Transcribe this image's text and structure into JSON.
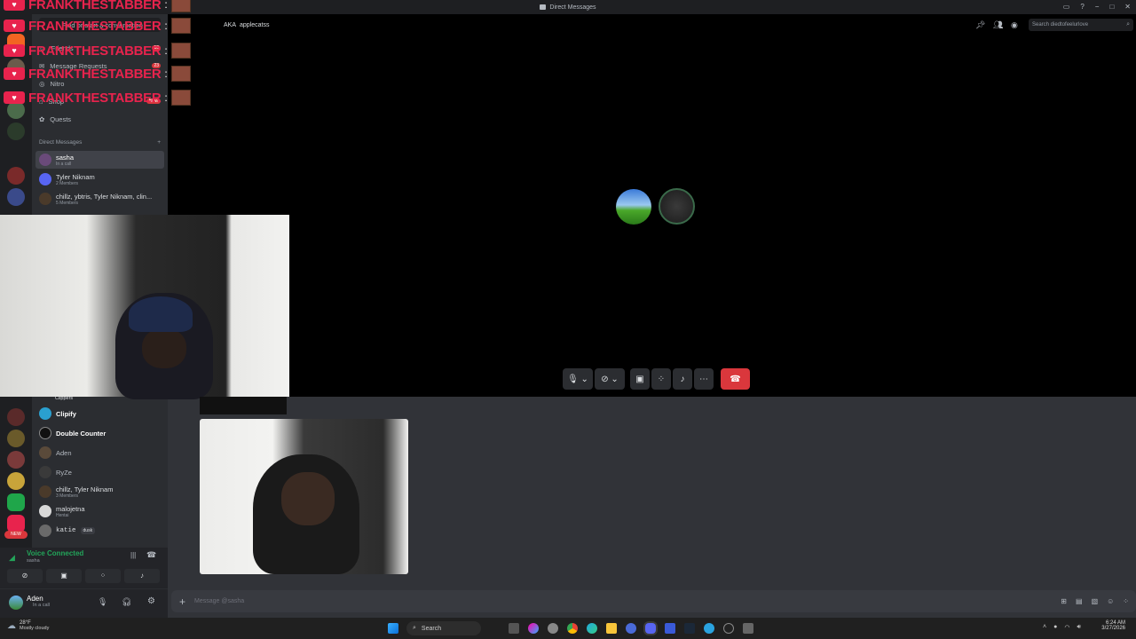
{
  "window": {
    "title": "Direct Messages",
    "controls": [
      "−",
      "□",
      "✕"
    ]
  },
  "overlay": {
    "repeat_name": "FRANKTHESTABBER",
    "rows": 5
  },
  "sidebar": {
    "nav": [
      {
        "label": "Find or start a conversation"
      },
      {
        "label": "Friends",
        "count": "10"
      },
      {
        "label": "Message Requests",
        "count": "23"
      },
      {
        "label": "Nitro"
      },
      {
        "label": "Shop",
        "badge": "New"
      },
      {
        "label": "Quests"
      }
    ],
    "dm_header": "Direct Messages",
    "dms_top": [
      {
        "name": "sasha",
        "status": "In a call"
      },
      {
        "name": "Tyler Niknam",
        "status": "2 Members"
      },
      {
        "name": "chillz, ybtris, Tyler Niknam, clin...",
        "status": "5 Members"
      }
    ],
    "dms_bottom": [
      {
        "name": "Clippers",
        "status": ""
      },
      {
        "name": "Clipify",
        "status": ""
      },
      {
        "name": "Double Counter",
        "status": ""
      },
      {
        "name": "Aden",
        "status": ""
      },
      {
        "name": "RyZe",
        "status": ""
      },
      {
        "name": "chillz, Tyler Niknam",
        "status": "3 Members"
      },
      {
        "name": "malojetna",
        "status": "Hentai"
      },
      {
        "name": "katie",
        "status": "dusk"
      }
    ]
  },
  "voice": {
    "title": "Voice Connected",
    "channel": "sasha"
  },
  "user": {
    "name": "Aden",
    "status": "In a call"
  },
  "call": {
    "topbar_names": [
      "AKA",
      "applecatss"
    ],
    "search_placeholder": "Search diedtofeelurlove"
  },
  "message": {
    "placeholder": "Message @sasha"
  },
  "taskbar": {
    "weather_temp": "28°F",
    "weather_desc": "Mostly cloudy",
    "search_label": "Search",
    "time": "6:24 AM",
    "date": "3/27/2026"
  },
  "colors": {
    "accent": "#5865f2",
    "danger": "#da373c",
    "overlay": "#e8234d",
    "online": "#23a55a"
  }
}
